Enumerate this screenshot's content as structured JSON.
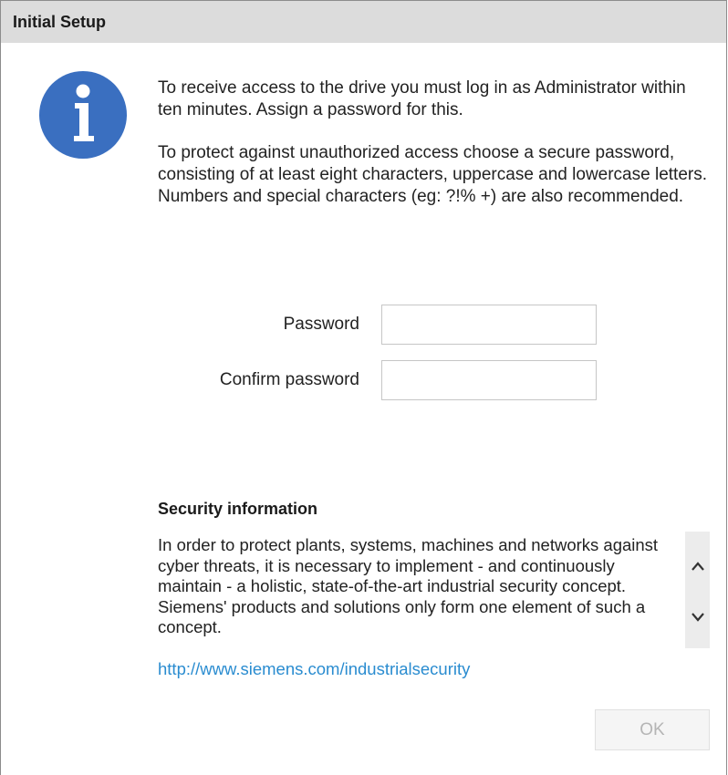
{
  "window": {
    "title": "Initial Setup"
  },
  "info": {
    "paragraph1": "To receive access to the drive you must log in as Administrator within ten minutes. Assign a password for this.",
    "paragraph2": "To protect against unauthorized access choose a secure password, consisting of at least eight characters, uppercase and lowercase letters. Numbers and special characters (eg: ?!% +) are also recommended."
  },
  "form": {
    "password_label": "Password",
    "password_value": "",
    "confirm_label": "Confirm password",
    "confirm_value": ""
  },
  "security": {
    "title": "Security information",
    "text": "In order to protect plants, systems, machines and networks against cyber threats, it is necessary to implement - and continuously maintain - a holistic, state-of-the-art industrial security concept. Siemens' products and solutions only form one element of such a concept.",
    "link": "http://www.siemens.com/industrialsecurity"
  },
  "buttons": {
    "ok_label": "OK",
    "ok_enabled": false
  },
  "icons": {
    "info": "info-icon",
    "scroll_up": "chevron-up-icon",
    "scroll_down": "chevron-down-icon"
  },
  "colors": {
    "info_icon": "#3a6fc0",
    "link": "#2a8cd0",
    "titlebar": "#dcdcdc"
  }
}
